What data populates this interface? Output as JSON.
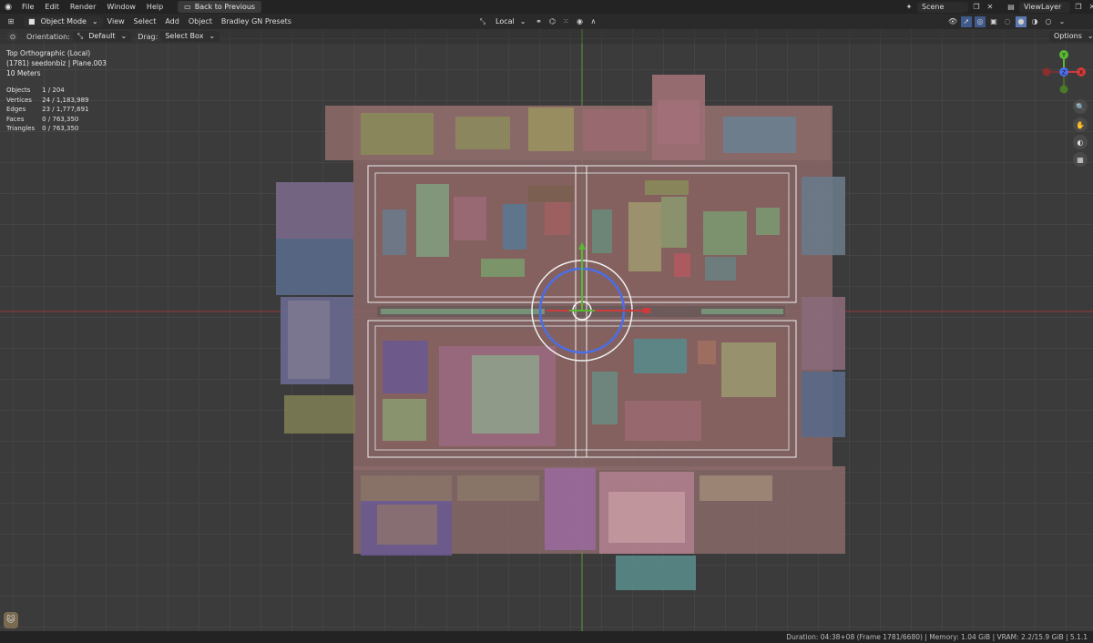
{
  "topmenu": {
    "items": [
      "File",
      "Edit",
      "Render",
      "Window",
      "Help"
    ],
    "back_label": "Back to Previous",
    "scene": "Scene",
    "viewlayer": "ViewLayer"
  },
  "header": {
    "mode": "Object Mode",
    "menus": [
      "View",
      "Select",
      "Add",
      "Object",
      "Bradley GN Presets"
    ],
    "transform_orientation": "Local",
    "options": "Options"
  },
  "toolbar": {
    "orientation_label": "Orientation:",
    "orientation_value": "Default",
    "drag_label": "Drag:",
    "drag_value": "Select Box"
  },
  "viewport": {
    "view_name": "Top Orthographic (Local)",
    "object_info": "(1781) seedonbiz | Plane.003",
    "scale": "10 Meters"
  },
  "stats": [
    {
      "label": "Objects",
      "value": "1 / 204"
    },
    {
      "label": "Vertices",
      "value": "24 / 1,183,989"
    },
    {
      "label": "Edges",
      "value": "23 / 1,777,691"
    },
    {
      "label": "Faces",
      "value": "0 / 763,350"
    },
    {
      "label": "Triangles",
      "value": "0 / 763,350"
    }
  ],
  "gizmo": {
    "y": "Y",
    "x": "X",
    "z": "Z"
  },
  "status": "Duration: 04:38+08 (Frame 1781/6680) | Memory: 1.04 GiB | VRAM: 2.2/15.9 GiB | 5.1.1",
  "colors": {
    "accent": "#e06060",
    "x_axis": "#a63a3a",
    "y_axis": "#5aa832",
    "gizmo_blue": "#4a6ee8"
  }
}
